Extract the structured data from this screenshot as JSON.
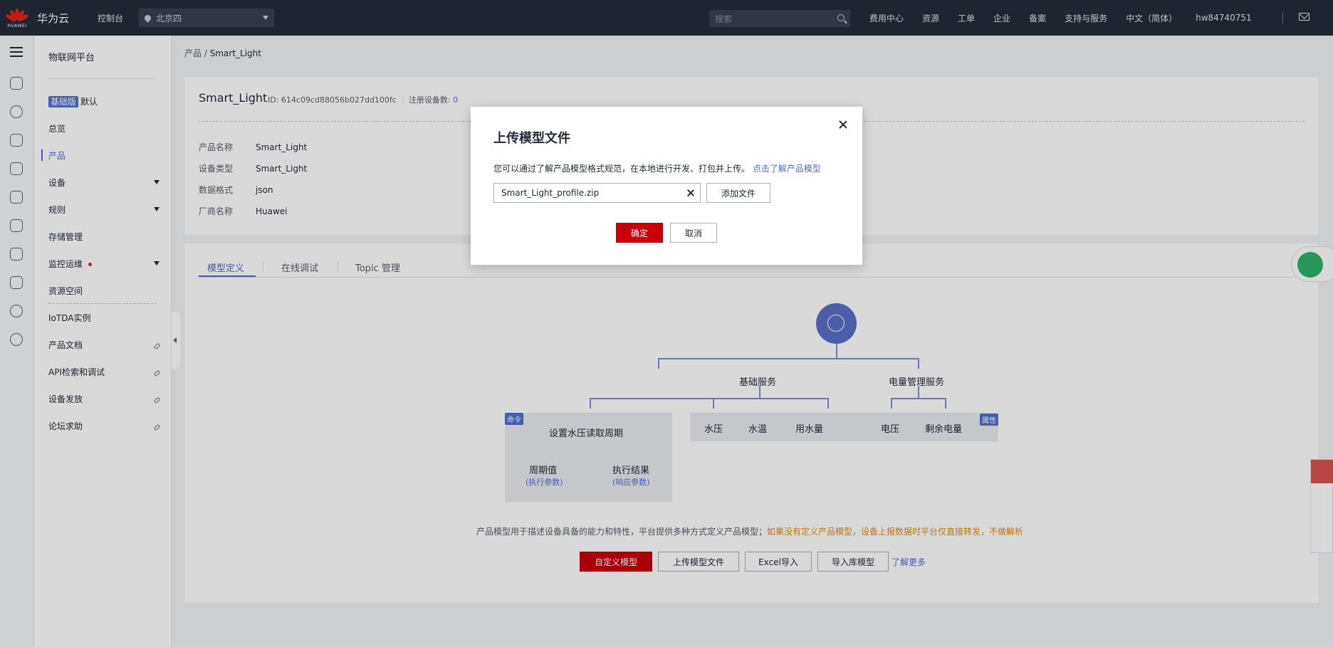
{
  "topbar": {
    "logo_text": "HUAWEI",
    "brand": "华为云",
    "console": "控制台",
    "region": "北京四",
    "search_placeholder": "搜索",
    "links": [
      "费用中心",
      "资源",
      "工单",
      "企业",
      "备案",
      "支持与服务",
      "中文（简体）",
      "hw84740751"
    ]
  },
  "sidebar": {
    "title": "物联网平台",
    "edition_badge": "基础版",
    "edition_value": "默认",
    "items": [
      "总览",
      "产品",
      "设备",
      "规则",
      "存储管理",
      "监控运维",
      "资源空间",
      "IoTDA实例",
      "产品文档",
      "API检索和调试",
      "设备发放",
      "论坛求助"
    ]
  },
  "breadcrumb": {
    "parent": "产品",
    "sep": "/",
    "current": "Smart_Light"
  },
  "product": {
    "name": "Smart_Light",
    "id_text": "ID: 614c09cd88056b027dd100fc",
    "registered_label": "注册设备数:",
    "registered_count": "0",
    "fields": [
      {
        "key": "产品名称",
        "value": "Smart_Light"
      },
      {
        "key": "设备类型",
        "value": "Smart_Light"
      },
      {
        "key": "数据格式",
        "value": "json"
      },
      {
        "key": "厂商名称",
        "value": "Huawei"
      }
    ]
  },
  "tabs": [
    "模型定义",
    "在线调试",
    "Topic 管理"
  ],
  "model_tree": {
    "services": [
      "基础服务",
      "电量管理服务"
    ],
    "command_tag": "命令",
    "property_tag": "属性",
    "command": "设置水压读取周期",
    "command_params": [
      {
        "name": "周期值",
        "type": "(执行参数)"
      },
      {
        "name": "执行结果",
        "type": "(响应参数)"
      }
    ],
    "properties": [
      "水压",
      "水温",
      "用水量",
      "电压",
      "剩余电量"
    ]
  },
  "note": {
    "text": "产品模型用于描述设备具备的能力和特性，平台提供多种方式定义产品模型；",
    "warning": "如果没有定义产品模型，设备上报数据时平台仅直接转发，不做解析"
  },
  "actions": {
    "custom": "自定义模型",
    "upload": "上传模型文件",
    "excel": "Excel导入",
    "library": "导入库模型",
    "learn_more": "了解更多"
  },
  "modal": {
    "title": "上传模型文件",
    "desc": "您可以通过了解产品模型格式规范，在本地进行开发、打包并上传。",
    "desc_link": "点击了解产品模型",
    "file_value": "Smart_Light_profile.zip",
    "add_file": "添加文件",
    "ok": "确定",
    "cancel": "取消"
  },
  "colors": {
    "topbar": "#252b3a",
    "accent": "#526ecc",
    "primary_button": "#c7000b",
    "warning": "#e68a00"
  }
}
